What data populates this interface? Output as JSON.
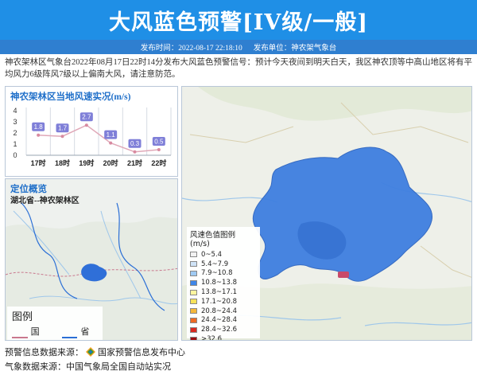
{
  "header": {
    "title": "大风蓝色预警[IV级/一般]",
    "publish_time_label": "发布时间：2022-08-17 22:18:10",
    "publisher_label": "发布单位：神农架气象台"
  },
  "description": "神农架林区气象台2022年08月17日22时14分发布大风蓝色预警信号：预计今天夜间到明天白天，我区神农顶等中高山地区将有平均风力6级阵风7级以上偏南大风，请注意防范。",
  "wind_chart": {
    "title": "神农架林区当地风速实况(m/s)",
    "y_ticks": [
      "0",
      "1",
      "2",
      "3",
      "4"
    ],
    "x_labels": [
      "17时",
      "18时",
      "19时",
      "20时",
      "21时",
      "22时"
    ],
    "value_labels": [
      "1.8",
      "1.7",
      "2.7",
      "1.1",
      "0.3",
      "0.5"
    ]
  },
  "chart_data": {
    "type": "line",
    "title": "神农架林区当地风速实况(m/s)",
    "xlabel": "",
    "ylabel": "",
    "categories": [
      "17时",
      "18时",
      "19时",
      "20时",
      "21时",
      "22时"
    ],
    "values": [
      1.8,
      1.7,
      2.7,
      1.1,
      0.3,
      0.5
    ],
    "ylim": [
      0,
      4
    ],
    "grid": "vertical",
    "colors": {
      "line": "#e0a8b8",
      "marker": "#7f7fd8"
    }
  },
  "location": {
    "title": "定位概览",
    "subtitle": "湖北省--神农架林区",
    "legend_title": "图例",
    "legend_items": [
      {
        "label": "国界",
        "color": "#c9788e"
      },
      {
        "label": "省界",
        "color": "#2b6fd6"
      }
    ]
  },
  "color_legend": {
    "title": "风速色值图例 (m/s)",
    "items": [
      {
        "label": "0~5.4",
        "color": "#f2f2f2"
      },
      {
        "label": "5.4~7.9",
        "color": "#cfe3f7"
      },
      {
        "label": "7.9~10.8",
        "color": "#9fcaf3"
      },
      {
        "label": "10.8~13.8",
        "color": "#3f87e8"
      },
      {
        "label": "13.8~17.1",
        "color": "#fdf5a0"
      },
      {
        "label": "17.1~20.8",
        "color": "#f7e25a"
      },
      {
        "label": "20.8~24.4",
        "color": "#f5b73a"
      },
      {
        "label": "24.4~28.4",
        "color": "#ee6a23"
      },
      {
        "label": "28.4~32.6",
        "color": "#d92a1f"
      },
      {
        "label": ">32.6",
        "color": "#9b1010"
      }
    ]
  },
  "footer": {
    "warning_source": "预警信息数据来源：",
    "warning_source_org": "国家预警信息发布中心",
    "weather_source": "气象数据来源：中国气象局全国自动站实况"
  },
  "colors": {
    "title_bar": "#1f8fe6",
    "info_bar": "#2f7fd0",
    "warning_region": "#3f7fe0"
  }
}
